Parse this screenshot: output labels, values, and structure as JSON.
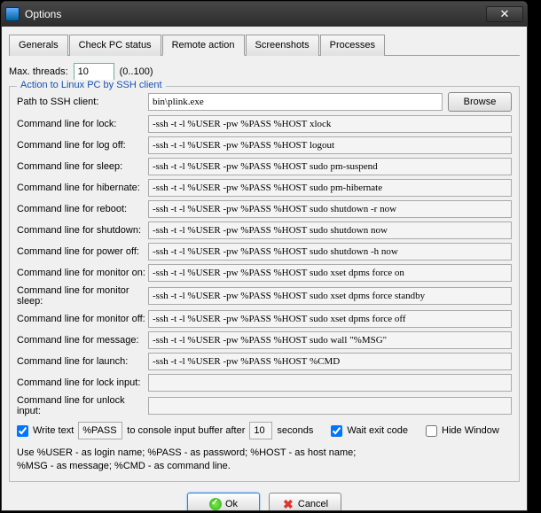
{
  "window": {
    "title": "Options"
  },
  "tabs": {
    "generals": "Generals",
    "check_pc": "Check PC status",
    "remote": "Remote action",
    "screenshots": "Screenshots",
    "processes": "Processes"
  },
  "threads": {
    "label": "Max. threads:",
    "value": "10",
    "range": "(0..100)"
  },
  "fieldset_title": "Action to Linux PC by SSH client",
  "rows": {
    "path": {
      "label": "Path to SSH client:",
      "value": "bin\\plink.exe"
    },
    "lock": {
      "label": "Command line for lock:",
      "value": "-ssh -t -l %USER -pw %PASS %HOST xlock"
    },
    "logoff": {
      "label": "Command line for log off:",
      "value": "-ssh -t -l %USER -pw %PASS %HOST logout"
    },
    "sleep": {
      "label": "Command line for sleep:",
      "value": "-ssh -t -l %USER -pw %PASS %HOST sudo pm-suspend"
    },
    "hibernate": {
      "label": "Command line for hibernate:",
      "value": "-ssh -t -l %USER -pw %PASS %HOST sudo pm-hibernate"
    },
    "reboot": {
      "label": "Command line for reboot:",
      "value": "-ssh -t -l %USER -pw %PASS %HOST sudo shutdown -r now"
    },
    "shutdown": {
      "label": "Command line for shutdown:",
      "value": "-ssh -t -l %USER -pw %PASS %HOST sudo shutdown now"
    },
    "poweroff": {
      "label": "Command line for power off:",
      "value": "-ssh -t -l %USER -pw %PASS %HOST sudo shutdown -h now"
    },
    "monon": {
      "label": "Command line for monitor on:",
      "value": "-ssh -t -l %USER -pw %PASS %HOST sudo xset dpms force on"
    },
    "monsleep": {
      "label": "Command line for monitor sleep:",
      "value": "-ssh -t -l %USER -pw %PASS %HOST sudo xset dpms force standby"
    },
    "monoff": {
      "label": "Command line for monitor off:",
      "value": "-ssh -t -l %USER -pw %PASS %HOST sudo xset dpms force off"
    },
    "message": {
      "label": "Command line for message:",
      "value": "-ssh -t -l %USER -pw %PASS %HOST sudo wall \"%MSG\""
    },
    "launch": {
      "label": "Command line for launch:",
      "value": "-ssh -t -l %USER -pw %PASS %HOST %CMD"
    },
    "lockinput": {
      "label": "Command line for lock input:",
      "value": ""
    },
    "unlockinput": {
      "label": "Command line for unlock input:",
      "value": ""
    }
  },
  "browse": "Browse",
  "checks": {
    "write_text": "Write text",
    "pass_token": "%PASS",
    "buffer_text": "to console input buffer after",
    "seconds_value": "10",
    "seconds_label": "seconds",
    "wait_exit": "Wait exit code",
    "hide_window": "Hide Window"
  },
  "hint": {
    "line1": "Use %USER - as login name; %PASS - as password; %HOST - as host name;",
    "line2": "%MSG - as message; %CMD - as command line."
  },
  "buttons": {
    "ok": "Ok",
    "cancel": "Cancel"
  }
}
